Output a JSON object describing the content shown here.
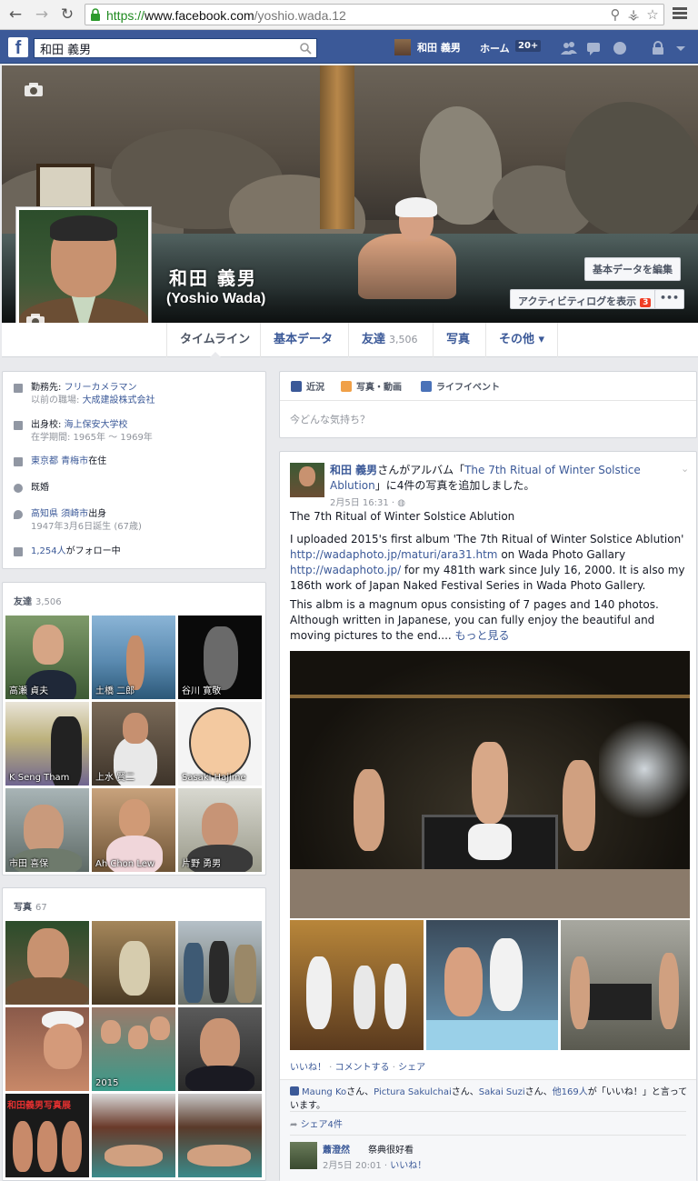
{
  "browser": {
    "url_scheme": "https://",
    "url_host": "www.facebook.com",
    "url_path": "/yoshio.wada.12"
  },
  "fbbar": {
    "logo": "f",
    "search_value": "和田 義男",
    "user_name": "和田 義男",
    "home_label": "ホーム",
    "home_badge": "20+"
  },
  "profile": {
    "name_jp": "和田 義男",
    "name_en": "(Yoshio Wada)",
    "edit_button": "基本データを編集",
    "activity_button": "アクティビティログを表示",
    "activity_count": "3",
    "more_button": "•••"
  },
  "tabs": [
    {
      "label": "タイムライン"
    },
    {
      "label": "基本データ"
    },
    {
      "label": "友達",
      "count": "3,506"
    },
    {
      "label": "写真"
    },
    {
      "label": "その他 ▾"
    }
  ],
  "intro": {
    "work_label": "勤務先: ",
    "work_value": "フリーカメラマン",
    "work_prev_label": "以前の職場: ",
    "work_prev_value": "大成建設株式会社",
    "school_label": "出身校: ",
    "school_value": "海上保安大学校",
    "school_years": "在学期間: 1965年 〜 1969年",
    "lives_city": "東京都 青梅市",
    "lives_suffix": "在住",
    "relationship": "既婚",
    "from_city": "高知県 須崎市",
    "from_suffix": "出身",
    "birthday": "1947年3月6日誕生 (67歳)",
    "followers_count": "1,254人",
    "followers_suffix": "がフォロー中"
  },
  "friends": {
    "title": "友達",
    "count": "3,506",
    "items": [
      {
        "name": "高瀬 貞夫"
      },
      {
        "name": "土橋 二郎"
      },
      {
        "name": "谷川 寛敬"
      },
      {
        "name": "K Seng Tham"
      },
      {
        "name": "上水 賢二"
      },
      {
        "name": "Sasaki Hajime"
      },
      {
        "name": "市田 喜保"
      },
      {
        "name": "Ah Chon Lew"
      },
      {
        "name": "片野 勇男"
      }
    ]
  },
  "photos": {
    "title": "写真",
    "count": "67",
    "badge_text": "和田義男写真展",
    "year_text": "2015"
  },
  "composer": {
    "tab_status": "近況",
    "tab_photo": "写真・動画",
    "tab_event": "ライフイベント",
    "prompt": "今どんな気持ち？"
  },
  "post": {
    "author": "和田 義男",
    "header_mid": "さんがアルバム「",
    "album": "The 7th Ritual of Winter Solstice Ablution",
    "header_end": "」に4件の写真を追加しました。",
    "meta": "2月5日 16:31 · ◍",
    "title": "The 7th Ritual of Winter Solstice Ablution",
    "p1_a": "I uploaded 2015's first album 'The 7th Ritual of Winter Solstice Ablution'",
    "p1_link1": "http://wadaphoto.jp/maturi/ara31.htm",
    "p1_b": " on Wada Photo Gallary",
    "p1_link2": "http://wadaphoto.jp/",
    "p1_c": " for my 481th wark since July 16, 2000. It is also my 186th work of Japan Naked Festival Series in Wada Photo Gallery.",
    "p2": "This albm is a magnum opus consisting of 7 pages and 140 photos. Although written in Japanese, you can fully enjoy the beautiful and moving pictures to the end.... ",
    "more": "もっと見る",
    "like": "いいね！",
    "comment": "コメントする",
    "share": "シェア",
    "likers_1": "Maung Ko",
    "likers_2": "Pictura Sakulchai",
    "likers_3": "Sakai Suzi",
    "likers_others": "他169人",
    "likers_tail": "が「いいね！」と言っています。",
    "shares": "シェア4件",
    "comment_author": "蕭澄然",
    "comment_text": "祭典很好看",
    "comment_meta": "2月5日 20:01 · ",
    "comment_like": "いいね！"
  }
}
